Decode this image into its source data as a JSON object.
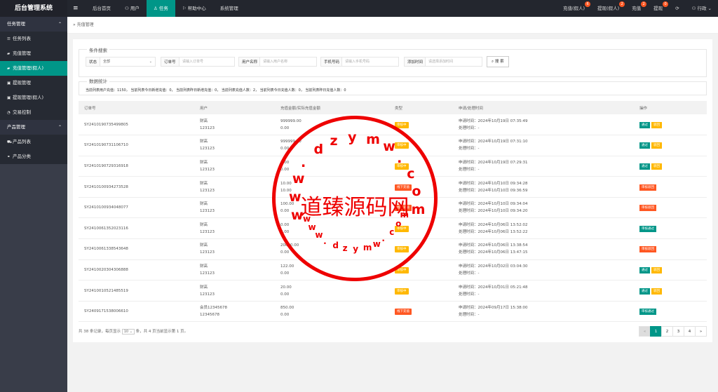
{
  "header": {
    "brand": "后台管理系统",
    "menu_icon": "menu-icon",
    "nav": [
      "后台首页",
      "用户",
      "任务",
      "帮助中心",
      "系统管理"
    ],
    "right": [
      {
        "label": "充值(假人)",
        "badge": "6"
      },
      {
        "label": "提现(假人)",
        "badge": "2"
      },
      {
        "label": "充值",
        "badge": "2"
      },
      {
        "label": "提现",
        "badge": "0"
      }
    ],
    "user": "行政"
  },
  "sidebar": {
    "groups": [
      {
        "label": "任务管理",
        "items": [
          "任务列表",
          "充值管理",
          "充值管理(假人)",
          "提现管理",
          "提现管理(假人)",
          "交易控制"
        ]
      },
      {
        "label": "产品管理",
        "items": [
          "产品列表",
          "产品分类"
        ]
      }
    ]
  },
  "breadcrumb": "充值管理",
  "search": {
    "legend": "条件搜索",
    "status_label": "状态",
    "status_value": "全部",
    "order_label": "订单号",
    "order_placeholder": "请输入订单号",
    "name_label": "用户名称",
    "name_placeholder": "请输入用户名称",
    "phone_label": "手机号码",
    "phone_placeholder": "请输入手机号码",
    "time_label": "添加时间",
    "time_placeholder": "请选择添加时间",
    "button": "搜 索"
  },
  "stats": {
    "legend": "数据统计",
    "text": "当前列表用户充值：1150， 当前列表今日新增充值：0， 当前列表昨日新增充值：0， 当前列表充值人数：2， 当前列表今日充值人数：0， 当前列表昨日充值人数：0"
  },
  "table": {
    "headers": [
      "订单号",
      "用户",
      "充值金额/实际充值金额",
      "类型",
      "申请/处理时间",
      "操作"
    ],
    "rows": [
      {
        "order": "SY2410190735499805",
        "user": "财高",
        "user2": "123123",
        "amt": "999999.00",
        "amt2": "0.00",
        "type": "审核中",
        "tc": "o",
        "apply": "申请时间：2024年10月19日 07:35:49",
        "proc": "处理时间：-",
        "ops": [
          {
            "t": "通过",
            "c": "g"
          },
          {
            "t": "驳回",
            "c": "y"
          }
        ]
      },
      {
        "order": "SY2410190731106710",
        "user": "财高",
        "user2": "123123",
        "amt": "999999.00",
        "amt2": "0.00",
        "type": "审核中",
        "tc": "o",
        "apply": "申请时间：2024年10月19日 07:31:10",
        "proc": "处理时间：-",
        "ops": [
          {
            "t": "通过",
            "c": "g"
          },
          {
            "t": "驳回",
            "c": "y"
          }
        ]
      },
      {
        "order": "SY2410190729316918",
        "user": "财高",
        "user2": "123123",
        "amt": "1.00",
        "amt2": "0.00",
        "type": "审核中",
        "tc": "o",
        "apply": "申请时间：2024年10月19日 07:29:31",
        "proc": "处理时间：-",
        "ops": [
          {
            "t": "通过",
            "c": "g"
          },
          {
            "t": "驳回",
            "c": "y"
          }
        ]
      },
      {
        "order": "SY2410100934273528",
        "user": "财高",
        "user2": "123123",
        "amt": "10.00",
        "amt2": "10.00",
        "type": "线下充值",
        "tc": "r",
        "apply": "申请时间：2024年10月10日 09:34:28",
        "proc": "处理时间：2024年10月10日 09:36:59",
        "ops": [
          {
            "t": "审核驳回",
            "c": "r"
          }
        ]
      },
      {
        "order": "SY2410100934048077",
        "user": "财高",
        "user2": "123123",
        "amt": "100.00",
        "amt2": "0.00",
        "type": "线下充值",
        "tc": "r",
        "apply": "申请时间：2024年10月10日 09:34:04",
        "proc": "处理时间：2024年10月10日 09:34:20",
        "ops": [
          {
            "t": "审核驳回",
            "c": "r"
          }
        ]
      },
      {
        "order": "SY2410061352023116",
        "user": "财高",
        "user2": "123123",
        "amt": "0.00",
        "amt2": "0.00",
        "type": "审核中",
        "tc": "o",
        "apply": "申请时间：2024年10月06日 13:52:02",
        "proc": "处理时间：2024年10月06日 13:52:22",
        "ops": [
          {
            "t": "审核通过",
            "c": "g"
          }
        ]
      },
      {
        "order": "SY2410061338543648",
        "user": "财高",
        "user2": "123123",
        "amt": "20000.00",
        "amt2": "0.00",
        "type": "审核中",
        "tc": "o",
        "apply": "申请时间：2024年10月06日 13:38:54",
        "proc": "处理时间：2024年10月06日 13:47:15",
        "ops": [
          {
            "t": "审核驳回",
            "c": "r"
          }
        ]
      },
      {
        "order": "SY2410020304306888",
        "user": "财高",
        "user2": "123123",
        "amt": "122.00",
        "amt2": "0.00",
        "type": "审核中",
        "tc": "o",
        "apply": "申请时间：2024年10月02日 03:04:30",
        "proc": "处理时间：-",
        "ops": [
          {
            "t": "通过",
            "c": "g"
          },
          {
            "t": "驳回",
            "c": "y"
          }
        ]
      },
      {
        "order": "SY2410010521485519",
        "user": "财高",
        "user2": "123123",
        "amt": "20.00",
        "amt2": "0.00",
        "type": "审核中",
        "tc": "o",
        "apply": "申请时间：2024年10月01日 05:21:48",
        "proc": "处理时间：-",
        "ops": [
          {
            "t": "通过",
            "c": "g"
          },
          {
            "t": "驳回",
            "c": "y"
          }
        ]
      },
      {
        "order": "SY2409171538006610",
        "user": "会员12345678",
        "user2": "12345678",
        "amt": "850.00",
        "amt2": "0.00",
        "type": "线下充值",
        "tc": "r",
        "apply": "申请时间：2024年09月17日 15:38:00",
        "proc": "处理时间：-",
        "ops": [
          {
            "t": "审核通过",
            "c": "g"
          }
        ]
      }
    ]
  },
  "pagination": {
    "info_prefix": "共 38 条记录，每页显示",
    "page_size": "10",
    "info_suffix": "条，共 4 页当前显示第 1 页。",
    "pages": [
      "«",
      "1",
      "2",
      "3",
      "4",
      "»"
    ]
  },
  "watermark": {
    "title": "道臻源码网",
    "top_chars": [
      "w",
      "w",
      "w",
      ".",
      "d",
      "z",
      "y",
      "m",
      "w",
      ".",
      "c",
      "o",
      "m"
    ],
    "bottom_chars": [
      "w",
      "w",
      "w",
      ".",
      "d",
      "z",
      "y",
      "m",
      "w",
      ".",
      "c",
      "o",
      "m"
    ]
  },
  "colors": {
    "accent": "#009688",
    "warn": "#ffb800",
    "danger": "#ff5722",
    "watermark": "#e00000"
  }
}
